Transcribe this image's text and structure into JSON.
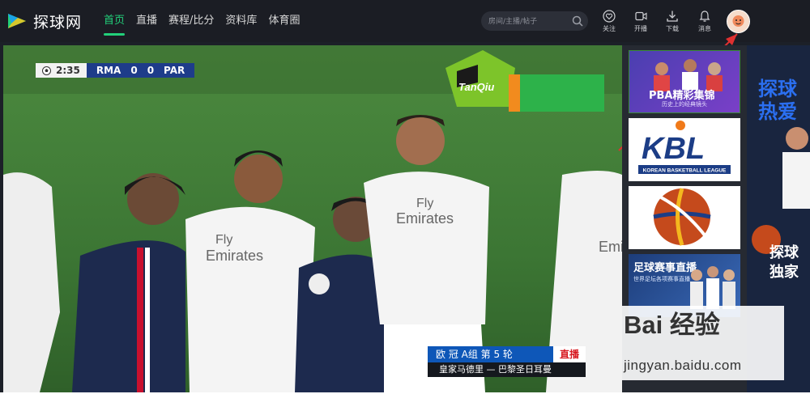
{
  "brand": {
    "name": "探球网",
    "accent": "#22d07a"
  },
  "nav": [
    {
      "label": "首页",
      "active": true
    },
    {
      "label": "直播"
    },
    {
      "label": "赛程/比分"
    },
    {
      "label": "资料库"
    },
    {
      "label": "体育圈"
    }
  ],
  "search": {
    "placeholder": "房间/主播/帖子"
  },
  "top_icons": [
    {
      "label": "关注",
      "icon": "heart-icon"
    },
    {
      "label": "开播",
      "icon": "video-camera-icon"
    },
    {
      "label": "下载",
      "icon": "download-icon"
    },
    {
      "label": "消息",
      "icon": "bell-icon"
    }
  ],
  "video": {
    "clock": "2:35",
    "home": "RMA",
    "home_score": "0",
    "away_score": "0",
    "away": "PAR",
    "overlay_logo": "TanQiu",
    "ticker_line1": "欧 冠  A组  第 5 轮",
    "ticker_live": "直播",
    "ticker_line2": "皇家马德里 — 巴黎圣日耳曼"
  },
  "sidebar": {
    "items": [
      {
        "title": "PBA精彩集锦",
        "subtitle": "历史上的经典镜头"
      },
      {
        "title": "KBL",
        "subtitle": "KOREAN BASKETBALL LEAGUE"
      },
      {
        "title": "basketball-logo"
      },
      {
        "title": "足球赛事直播",
        "subtitle": "世界足坛各项赛事直播"
      }
    ]
  },
  "right_banner": {
    "line1": "探球",
    "line2": "热爱",
    "line3": "探球",
    "line4": "独家"
  },
  "watermark": {
    "text": "Bai 经验",
    "url": "jingyan.baidu.com"
  }
}
